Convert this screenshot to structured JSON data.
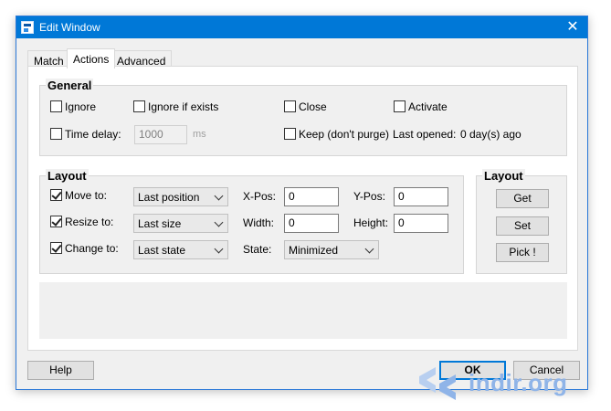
{
  "window": {
    "title": "Edit Window",
    "close_glyph": "✕"
  },
  "tabs": [
    {
      "label": "Match",
      "active": false
    },
    {
      "label": "Actions",
      "active": true
    },
    {
      "label": "Advanced",
      "active": false
    }
  ],
  "general": {
    "title": "General",
    "ignore_label": "Ignore",
    "ignore_checked": false,
    "ignore_if_exists_label": "Ignore if exists",
    "ignore_if_exists_checked": false,
    "close_label": "Close",
    "close_checked": false,
    "activate_label": "Activate",
    "activate_checked": false,
    "time_delay_label": "Time delay:",
    "time_delay_checked": false,
    "time_delay_value": "1000",
    "time_delay_unit": "ms",
    "keep_label": "Keep (don't purge)",
    "keep_checked": false,
    "last_opened_label": "Last opened:",
    "last_opened_value": "0 day(s) ago"
  },
  "layout": {
    "title": "Layout",
    "move_to_label": "Move to:",
    "move_to_checked": true,
    "move_to_value": "Last position",
    "resize_to_label": "Resize to:",
    "resize_to_checked": true,
    "resize_to_value": "Last size",
    "change_to_label": "Change to:",
    "change_to_checked": true,
    "change_to_value": "Last state",
    "xpos_label": "X-Pos:",
    "xpos_value": "0",
    "ypos_label": "Y-Pos:",
    "ypos_value": "0",
    "width_label": "Width:",
    "width_value": "0",
    "height_label": "Height:",
    "height_value": "0",
    "state_label": "State:",
    "state_value": "Minimized"
  },
  "layout_side": {
    "title": "Layout",
    "get_label": "Get",
    "set_label": "Set",
    "pick_label": "Pick !"
  },
  "footer": {
    "help_label": "Help",
    "ok_label": "OK",
    "cancel_label": "Cancel"
  },
  "watermark": {
    "text": "indir.org"
  },
  "colors": {
    "titlebar": "#0078d7",
    "default_button_border": "#0078d7",
    "watermark": "#8fb4e8"
  }
}
